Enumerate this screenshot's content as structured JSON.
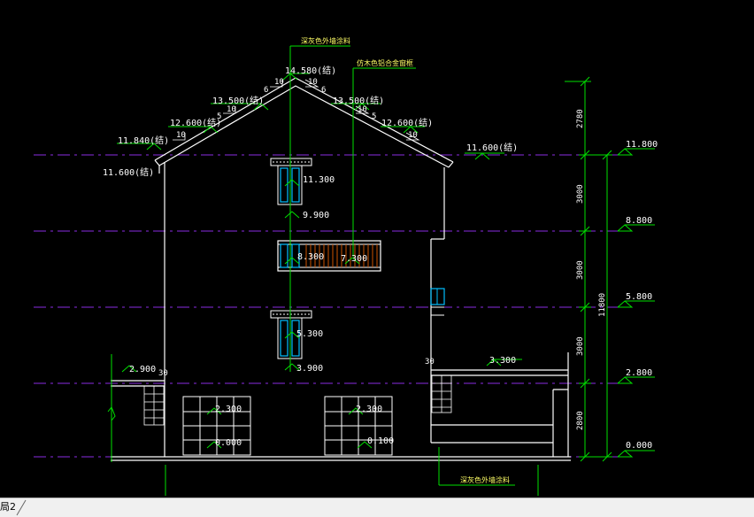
{
  "annotations": {
    "top_material": "深灰色外墙涂料",
    "roof_material": "仿木色铝合金窗框",
    "bottom_material": "深灰色外墙涂料"
  },
  "roof_levels": {
    "ridge": "14.580(结)",
    "left_upper": "13.500(结)",
    "right_upper": "13.500(结)",
    "left_mid": "12.600(结)",
    "right_mid": "12.600(结)",
    "left_eave": "11.840(结)",
    "left_low": "11.600(结)",
    "right_low": "11.600(结)"
  },
  "slope_labels": {
    "ten": "10",
    "six": "6",
    "five": "5"
  },
  "inner_levels": {
    "l1130": "11.300",
    "l990": "9.900",
    "l830": "8.300",
    "l730": "7.300",
    "l530": "5.300",
    "l390": "3.900",
    "l290": "2.900",
    "l330": "3.300",
    "l230a": "2.300",
    "l230b": "2.300",
    "l000": "0.000",
    "l010": "0.100",
    "n30a": "30",
    "n30b": "30"
  },
  "right_levels": {
    "r1180": "11.800",
    "r880": "8.800",
    "r580": "5.800",
    "r280": "2.800",
    "r000": "0.000"
  },
  "dimensions": {
    "d2780": "2780",
    "d3000a": "3000",
    "d3000b": "3000",
    "d3000c": "3000",
    "d2800": "2800",
    "total": "11800"
  },
  "tab": {
    "label": "局2"
  },
  "colors": {
    "background": "#000000",
    "outline": "#ffffff",
    "dimension": "#00e000",
    "floor_line": "#8a2be2",
    "window": "#00bfff",
    "railing": "#cc5500"
  }
}
